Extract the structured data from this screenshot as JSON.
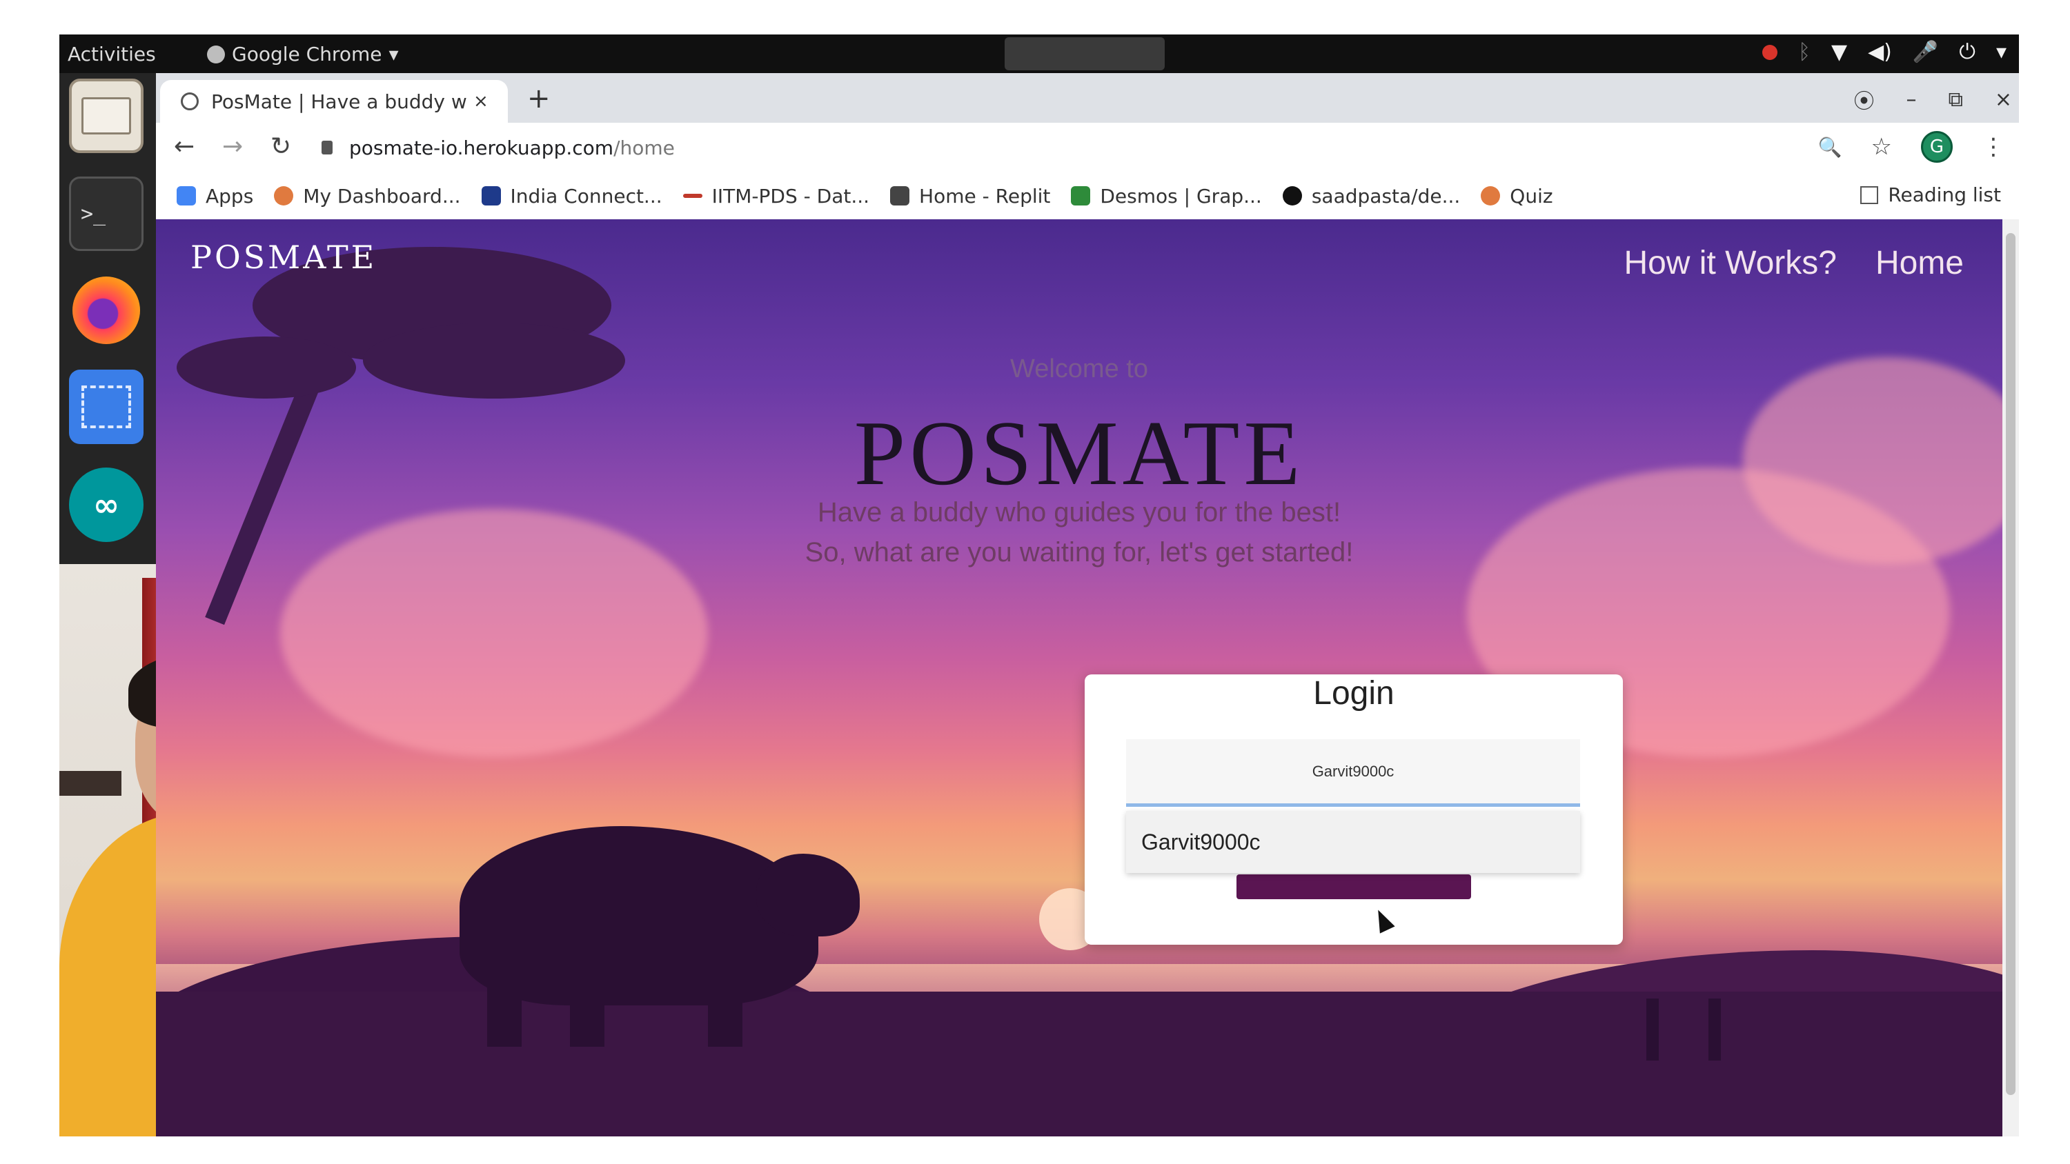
{
  "os": {
    "activities": "Activities",
    "app_menu": "Google Chrome",
    "app_menu_arrow": "▾",
    "tray_icons": [
      "record-icon",
      "bluetooth-icon",
      "wifi-icon",
      "volume-icon",
      "mic-icon",
      "power-icon",
      "chevron-down-icon"
    ]
  },
  "dock": {
    "items": [
      "files",
      "terminal",
      "firefox",
      "screenshot",
      "arduino"
    ],
    "terminal_prompt": ">_",
    "arduino_glyph": "∞"
  },
  "browser": {
    "tab": {
      "title": "PosMate | Have a buddy w",
      "close": "×"
    },
    "new_tab": "+",
    "window_controls": {
      "account": "⦿",
      "minimize": "–",
      "restore": "⧉",
      "close": "×"
    },
    "nav": {
      "back": "←",
      "forward": "→",
      "reload": "↻"
    },
    "address": {
      "host": "posmate-io.herokuapp.com",
      "path": "/home"
    },
    "toolbar_right": {
      "zoom": "🔍",
      "star": "☆",
      "avatar_letter": "G",
      "menu": "⋮"
    },
    "bookmarks": [
      {
        "label": "Apps",
        "color": "#4285f4"
      },
      {
        "label": "My Dashboard...",
        "color": "#e07a3f"
      },
      {
        "label": "India Connect...",
        "color": "#1e3a8a"
      },
      {
        "label": "IITM-PDS - Dat...",
        "color": "#c0392b"
      },
      {
        "label": "Home - Replit",
        "color": "#444444"
      },
      {
        "label": "Desmos | Grap...",
        "color": "#2e8b3a"
      },
      {
        "label": "saadpasta/de...",
        "color": "#111111"
      },
      {
        "label": "Quiz",
        "color": "#e07a3f"
      }
    ],
    "reading_list": "Reading list"
  },
  "page": {
    "brand": "POSMATE",
    "nav": {
      "how": "How it Works?",
      "home": "Home"
    },
    "welcome": "Welcome to",
    "title": "POSMATE",
    "tagline1": "Have a buddy who guides you for the best!",
    "tagline2": "So, what are you waiting for, let's get started!",
    "login": {
      "title": "Login",
      "input_value": "Garvit9000c",
      "suggestion": "Garvit9000c"
    }
  },
  "colors": {
    "login_button": "#5a1552",
    "input_focus": "#8fb8e8",
    "avatar": "#1e8e5f"
  }
}
